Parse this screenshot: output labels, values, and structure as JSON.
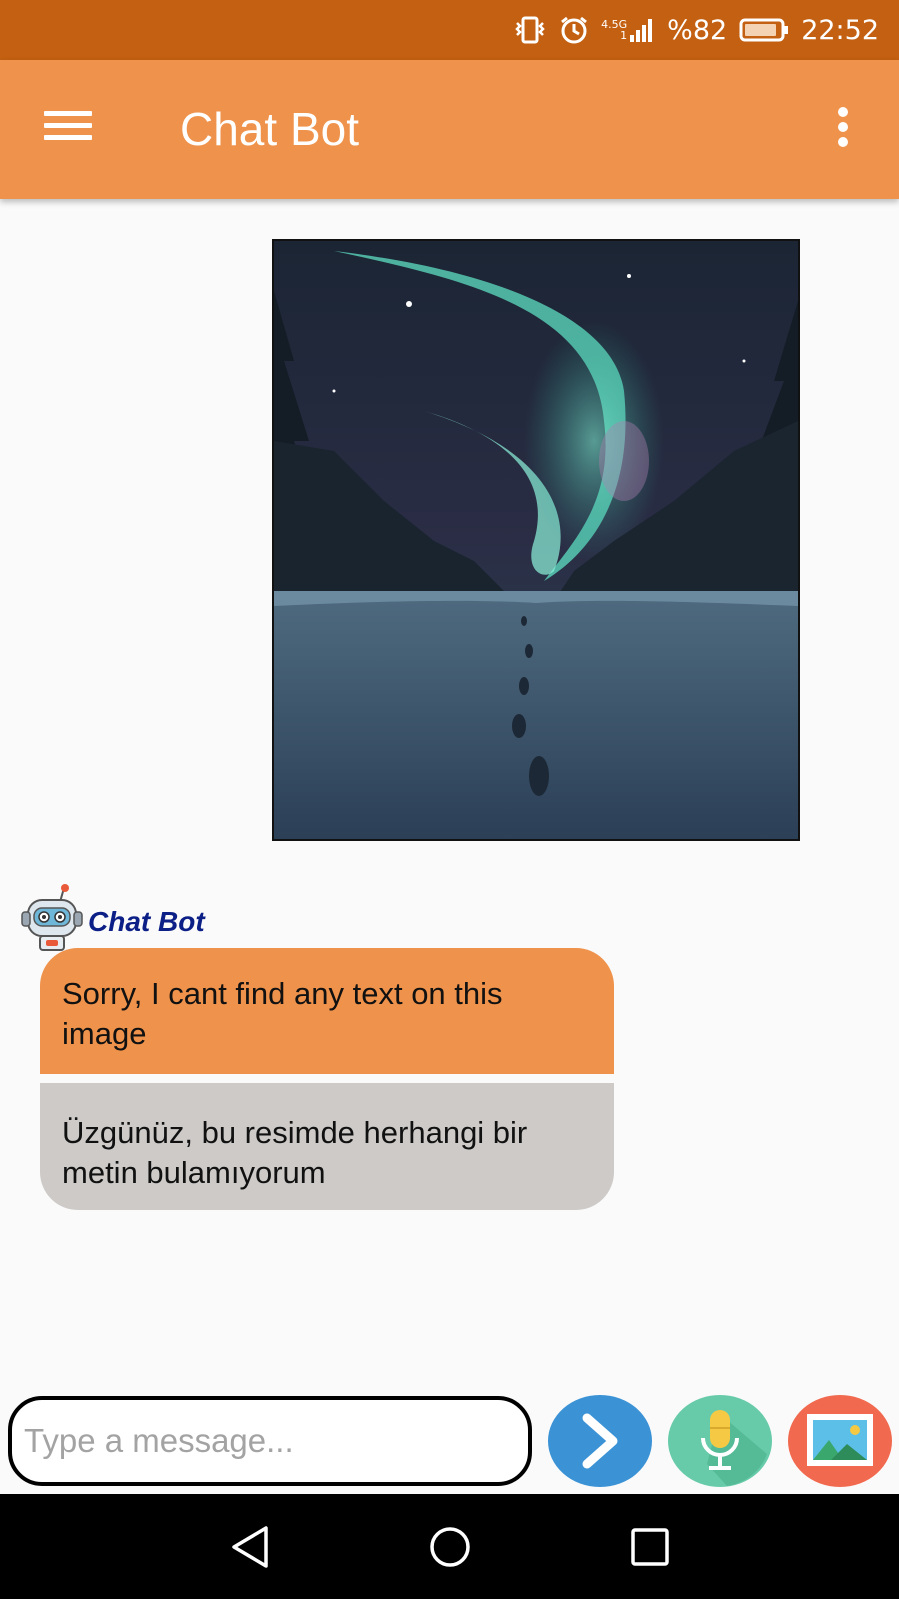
{
  "status_bar": {
    "network_label": "4.5G",
    "network_sub": "1",
    "battery": "%82",
    "time": "22:52",
    "icons": [
      "vibrate-icon",
      "alarm-icon",
      "signal-icon",
      "battery-icon"
    ]
  },
  "app_bar": {
    "title": "Chat Bot",
    "menu_icon": "hamburger-menu-icon",
    "overflow_icon": "more-vert-icon",
    "color": "#ef924b"
  },
  "messages": [
    {
      "type": "image",
      "sender": "user",
      "description_icon": "aurora-photo"
    },
    {
      "type": "bot",
      "sender_name": "Chat Bot",
      "text_en": "Sorry, I cant find any text on this image",
      "text_tr": "Üzgünüz, bu resimde herhangi bir metin bulamıyorum"
    }
  ],
  "composer": {
    "placeholder": "Type a message...",
    "value": "",
    "send_icon": "send-arrow-icon",
    "mic_icon": "microphone-icon",
    "gallery_icon": "gallery-image-icon"
  },
  "colors": {
    "status_bar": "#c46011",
    "accent": "#ef924b",
    "bot_name": "#0b1f86",
    "translation_bubble": "#cdcac8",
    "send": "#3b93d6",
    "mic": "#67cba9",
    "gallery": "#f16a4f"
  }
}
